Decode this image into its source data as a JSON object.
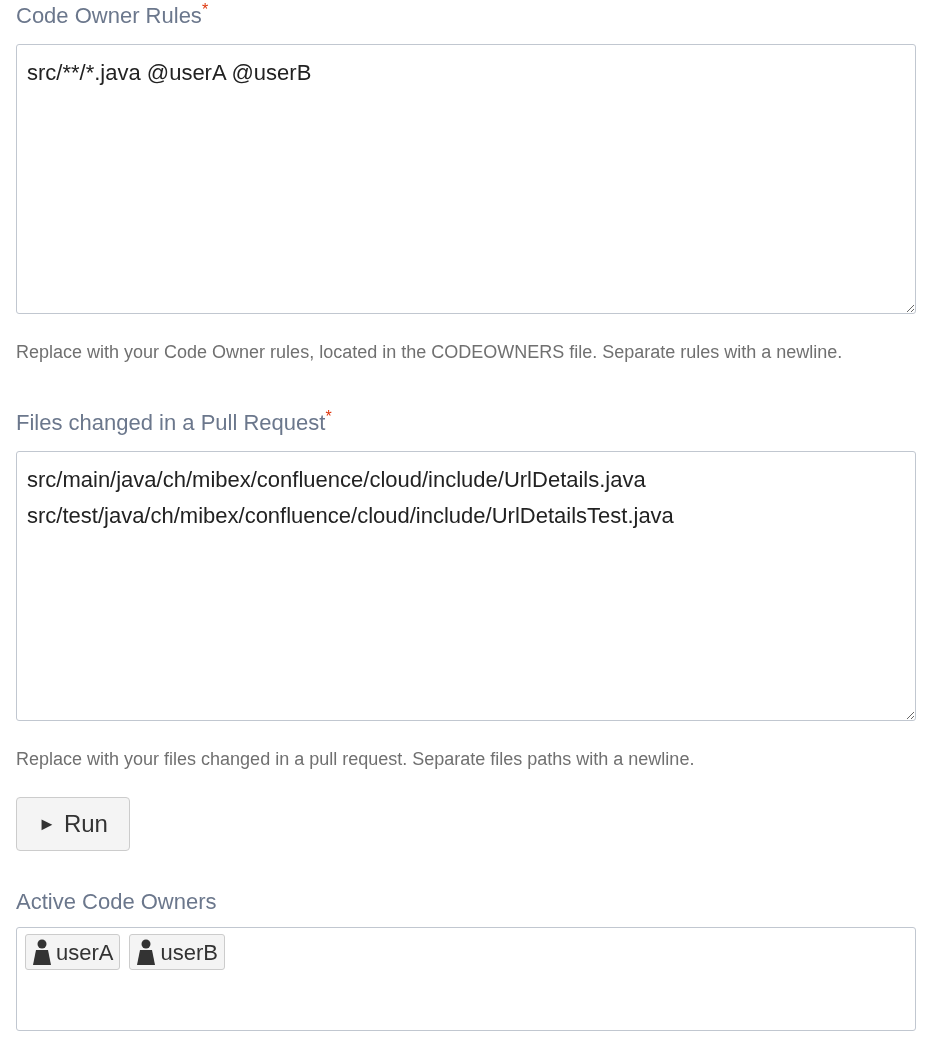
{
  "fields": [
    {
      "label": "Code Owner Rules",
      "required_mark": "*",
      "value": "src/**/*.java @userA @userB",
      "help": "Replace with your Code Owner rules, located in the CODEOWNERS file. Separate rules with a newline."
    },
    {
      "label": "Files changed in a Pull Request",
      "required_mark": "*",
      "value": "src/main/java/ch/mibex/confluence/cloud/include/UrlDetails.java\nsrc/test/java/ch/mibex/confluence/cloud/include/UrlDetailsTest.java",
      "help": "Replace with your files changed in a pull request. Separate files paths with a newline."
    }
  ],
  "run_button": {
    "icon": "►",
    "label": "Run"
  },
  "result": {
    "label": "Active Code Owners",
    "owners": [
      "userA",
      "userB"
    ]
  }
}
